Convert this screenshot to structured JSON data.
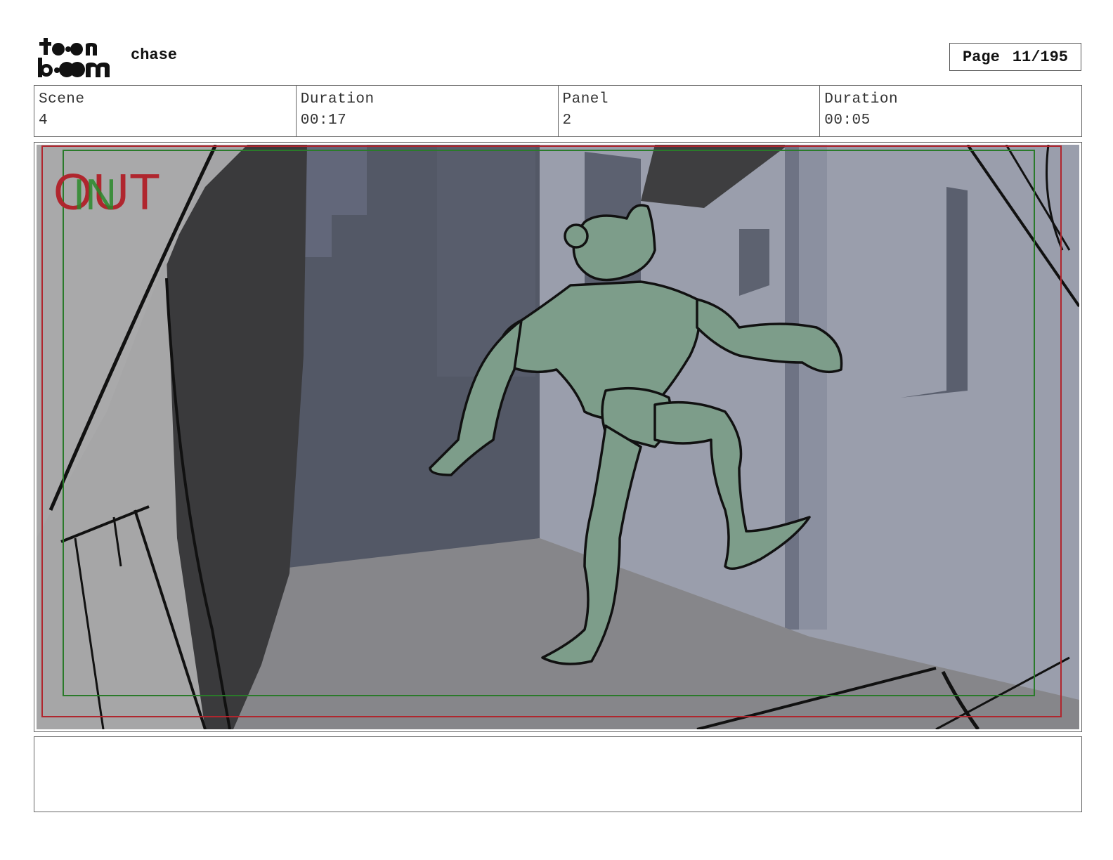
{
  "header": {
    "logo_text": "toon boom",
    "project_title": "chase",
    "page_label": "Page",
    "page_value": "11/195"
  },
  "info": [
    {
      "label": "Scene",
      "value": "4"
    },
    {
      "label": "Duration",
      "value": "00:17"
    },
    {
      "label": "Panel",
      "value": "2"
    },
    {
      "label": "Duration",
      "value": "00:05"
    }
  ],
  "panel": {
    "overlay_out": "OUT",
    "overlay_in": "IN",
    "colors": {
      "outer_safe_frame": "#b0262e",
      "inner_safe_frame": "#2a7a2a",
      "character_fill": "#7d9d8a",
      "wall_light": "#9b9fae",
      "wall_dark": "#4d525e",
      "floor": "#8a8a8e",
      "shadow": "#3a3a3c"
    }
  },
  "notes": {
    "text": ""
  }
}
